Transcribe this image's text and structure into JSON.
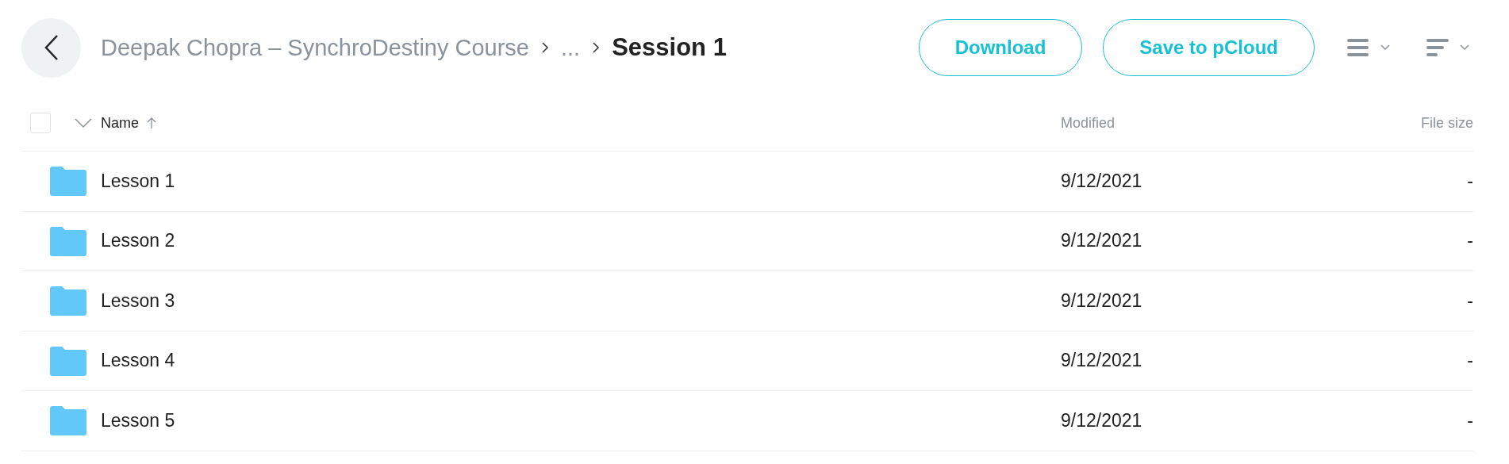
{
  "breadcrumb": {
    "items": [
      "Deepak Chopra – SynchroDestiny Course",
      "..."
    ],
    "current": "Session 1"
  },
  "actions": [
    "Download",
    "Save to pCloud"
  ],
  "table": {
    "select_all": {
      "checked": false
    },
    "columns": [
      "Name",
      "Modified",
      "File size"
    ],
    "rows": [
      {
        "name": "Lesson 1",
        "modified": "9/12/2021",
        "size": "-"
      },
      {
        "name": "Lesson 2",
        "modified": "9/12/2021",
        "size": "-"
      },
      {
        "name": "Lesson 3",
        "modified": "9/12/2021",
        "size": "-"
      },
      {
        "name": "Lesson 4",
        "modified": "9/12/2021",
        "size": "-"
      },
      {
        "name": "Lesson 5",
        "modified": "9/12/2021",
        "size": "-"
      }
    ]
  }
}
